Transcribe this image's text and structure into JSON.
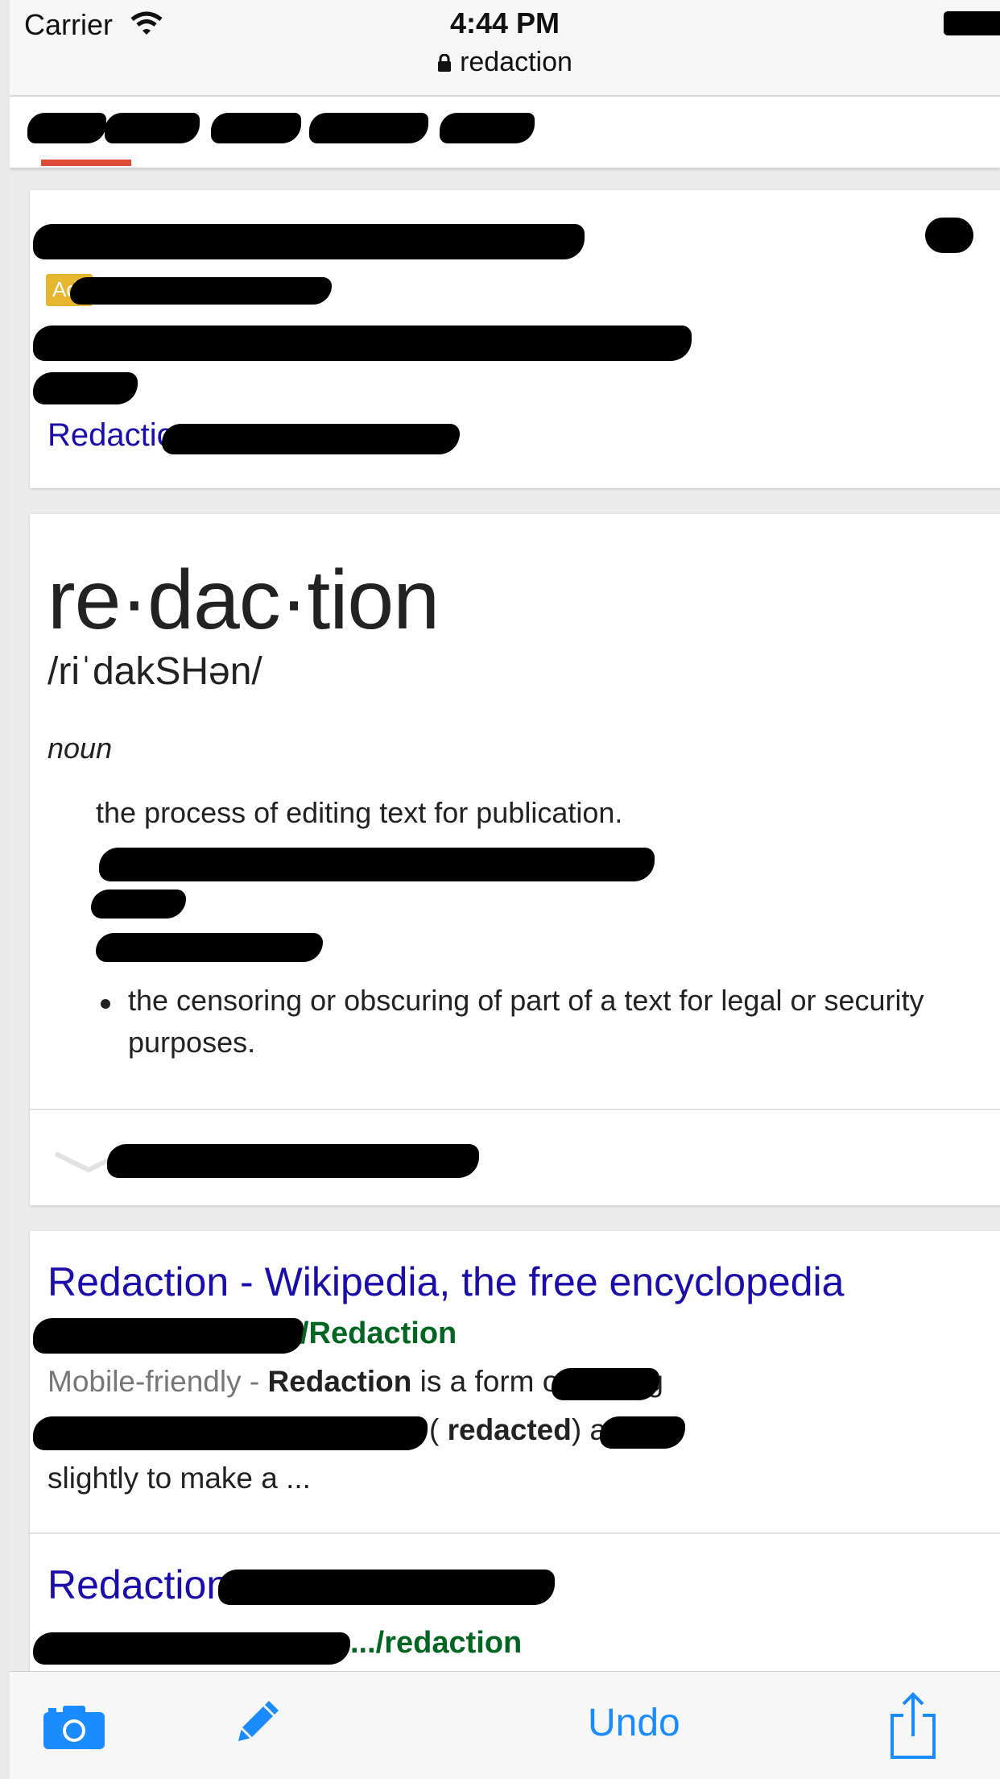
{
  "status_bar": {
    "carrier": "Carrier",
    "time": "4:44 PM",
    "url": "redaction"
  },
  "ad_card": {
    "badge": "Ad",
    "link_label": "Redaction"
  },
  "definition": {
    "word": "re·dac·tion",
    "phonetic": "/riˈdakSHən/",
    "part_of_speech": "noun",
    "definition_1": "the process of editing text for publication.",
    "definition_3": "the censoring or obscuring of part of a text for legal or security purposes."
  },
  "result_1": {
    "title": "Redaction - Wikipedia, the free encyclopedia",
    "url_suffix": "/Redaction",
    "snippet_label": "Mobile-friendly - ",
    "snippet_bold": "Redaction",
    "snippet_rest": " is a form of editing",
    "snippet_l2_open": "( ",
    "snippet_l2_bold": "redacted",
    "snippet_l2_rest": ") and",
    "snippet_l3": "slightly to make a ..."
  },
  "result_2": {
    "title_prefix": "Redaction -",
    "url_suffix": ".../redaction"
  },
  "toolbar": {
    "undo_label": "Undo",
    "accent": "#1a8cff"
  },
  "colors": {
    "link": "#1a0dab",
    "url_green": "#006621",
    "tab_indicator": "#dd4b39"
  }
}
